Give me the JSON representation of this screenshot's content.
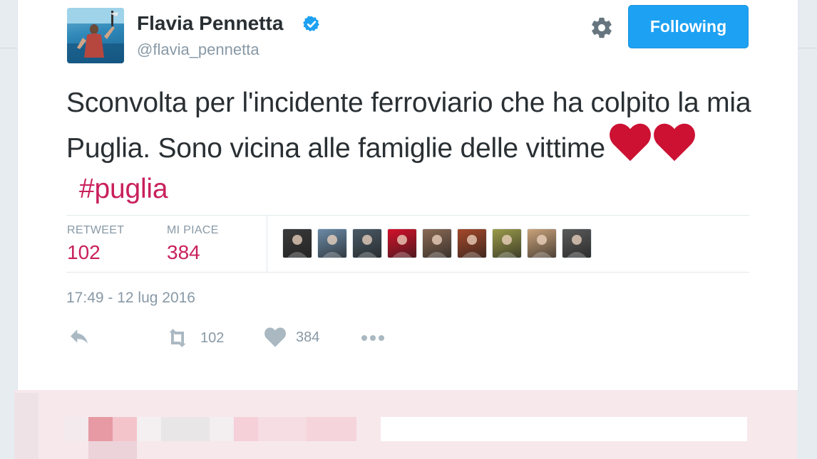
{
  "user": {
    "display_name": "Flavia Pennetta",
    "handle": "@flavia_pennetta",
    "verified": true
  },
  "follow_button": {
    "label": "Following"
  },
  "tweet": {
    "text": "Sconvolta per l'incidente ferroviario che ha colpito la mia Puglia. Sono vicina alle famiglie delle vittime",
    "emoji": [
      "red-heart",
      "red-heart"
    ],
    "hashtag": "#puglia"
  },
  "stats": {
    "retweets": {
      "label": "RETWEET",
      "value": "102"
    },
    "likes": {
      "label": "MI PIACE",
      "value": "384"
    }
  },
  "likers": [
    {
      "name": "liker-1",
      "color": "#3a3a3a"
    },
    {
      "name": "liker-2",
      "color": "#6b8aa6"
    },
    {
      "name": "liker-3",
      "color": "#4a5a66"
    },
    {
      "name": "liker-4",
      "color": "#d3112a"
    },
    {
      "name": "liker-5",
      "color": "#8a6a55"
    },
    {
      "name": "liker-6",
      "color": "#a4482a"
    },
    {
      "name": "liker-7",
      "color": "#9a9a4a"
    },
    {
      "name": "liker-8",
      "color": "#c9a27a"
    },
    {
      "name": "liker-9",
      "color": "#5b5b5b"
    }
  ],
  "timestamp": "17:49 - 12 lug 2016",
  "actions": {
    "reply": {
      "icon": "reply-icon"
    },
    "retweet": {
      "icon": "retweet-icon",
      "count": "102"
    },
    "like": {
      "icon": "heart-icon",
      "count": "384"
    },
    "more": {
      "icon": "more-icon"
    }
  },
  "colors": {
    "accent": "#1da1f2",
    "hashtag": "#c9205c",
    "muted": "#8899a6",
    "text": "#292f33",
    "heart": "#cc1133"
  }
}
